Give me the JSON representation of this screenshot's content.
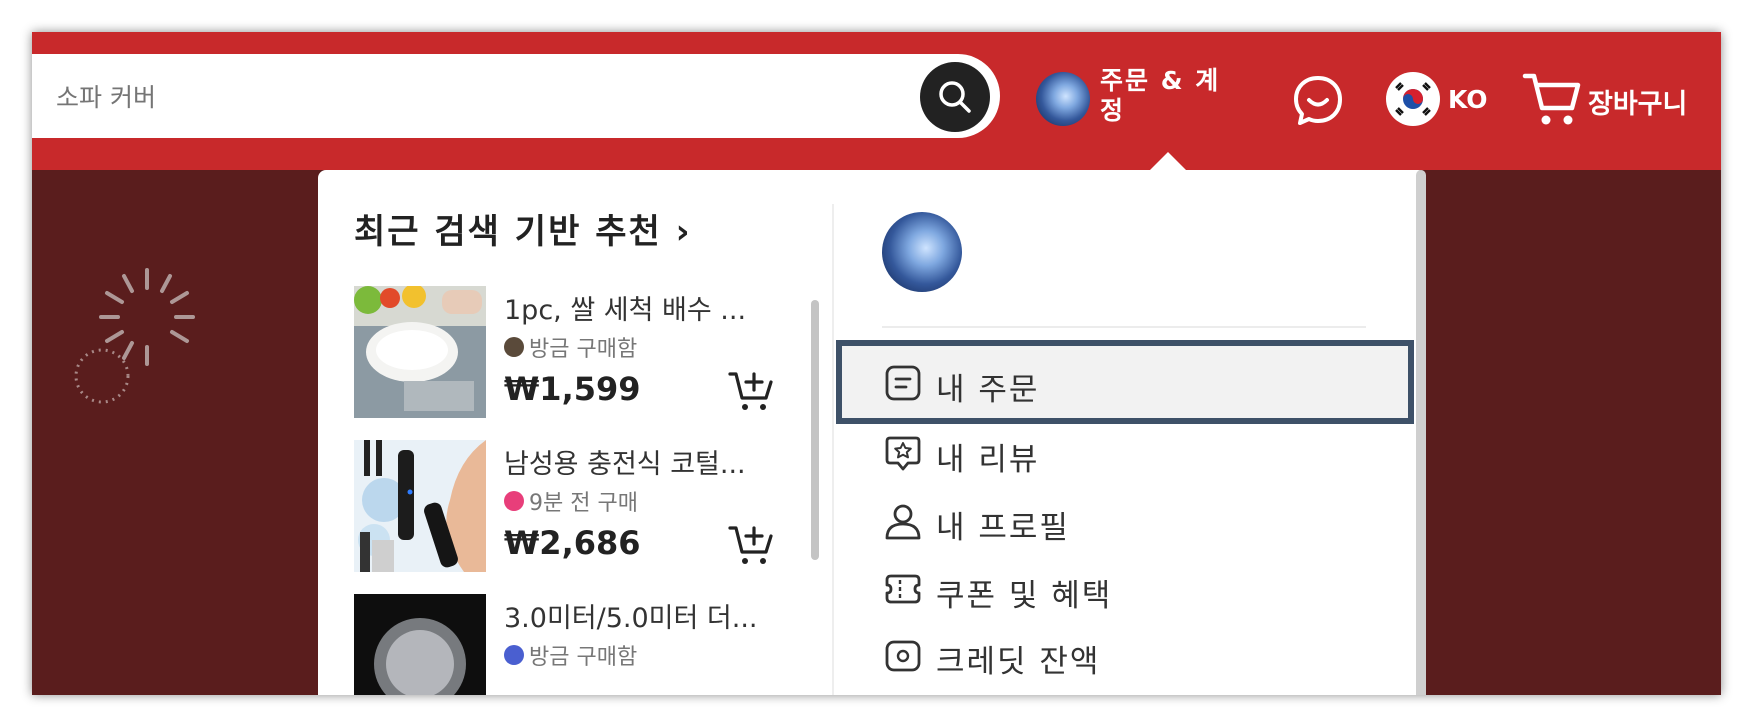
{
  "search": {
    "placeholder": "소파 커버"
  },
  "header": {
    "account_label": "주문 & 계정",
    "lang_label": "KO",
    "cart_label": "장바구니"
  },
  "dropdown": {
    "recommend_title": "최근 검색 기반 추천 ›",
    "products": [
      {
        "name": "1pc, 쌀 세척 배수 ...",
        "status": "방금 구매함",
        "status_color": "#5a4a3a",
        "price": "₩1,599"
      },
      {
        "name": "남성용 충전식 코털...",
        "status": "9분 전 구매",
        "status_color": "#e83e7a",
        "price": "₩2,686"
      },
      {
        "name": "3.0미터/5.0미터 더...",
        "status": "방금 구매함",
        "status_color": "#4a5fd0",
        "price": ""
      }
    ],
    "menu": [
      {
        "label": "내 주문",
        "icon": "order-list-icon"
      },
      {
        "label": "내 리뷰",
        "icon": "review-star-icon"
      },
      {
        "label": "내 프로필",
        "icon": "user-icon"
      },
      {
        "label": "쿠폰 및 혜택",
        "icon": "coupon-icon"
      },
      {
        "label": "크레딧 잔액",
        "icon": "wallet-icon"
      }
    ]
  },
  "colors": {
    "header_bg": "#c8292b",
    "backdrop": "#5a1d1d",
    "highlight_outline": "#3e5168"
  }
}
